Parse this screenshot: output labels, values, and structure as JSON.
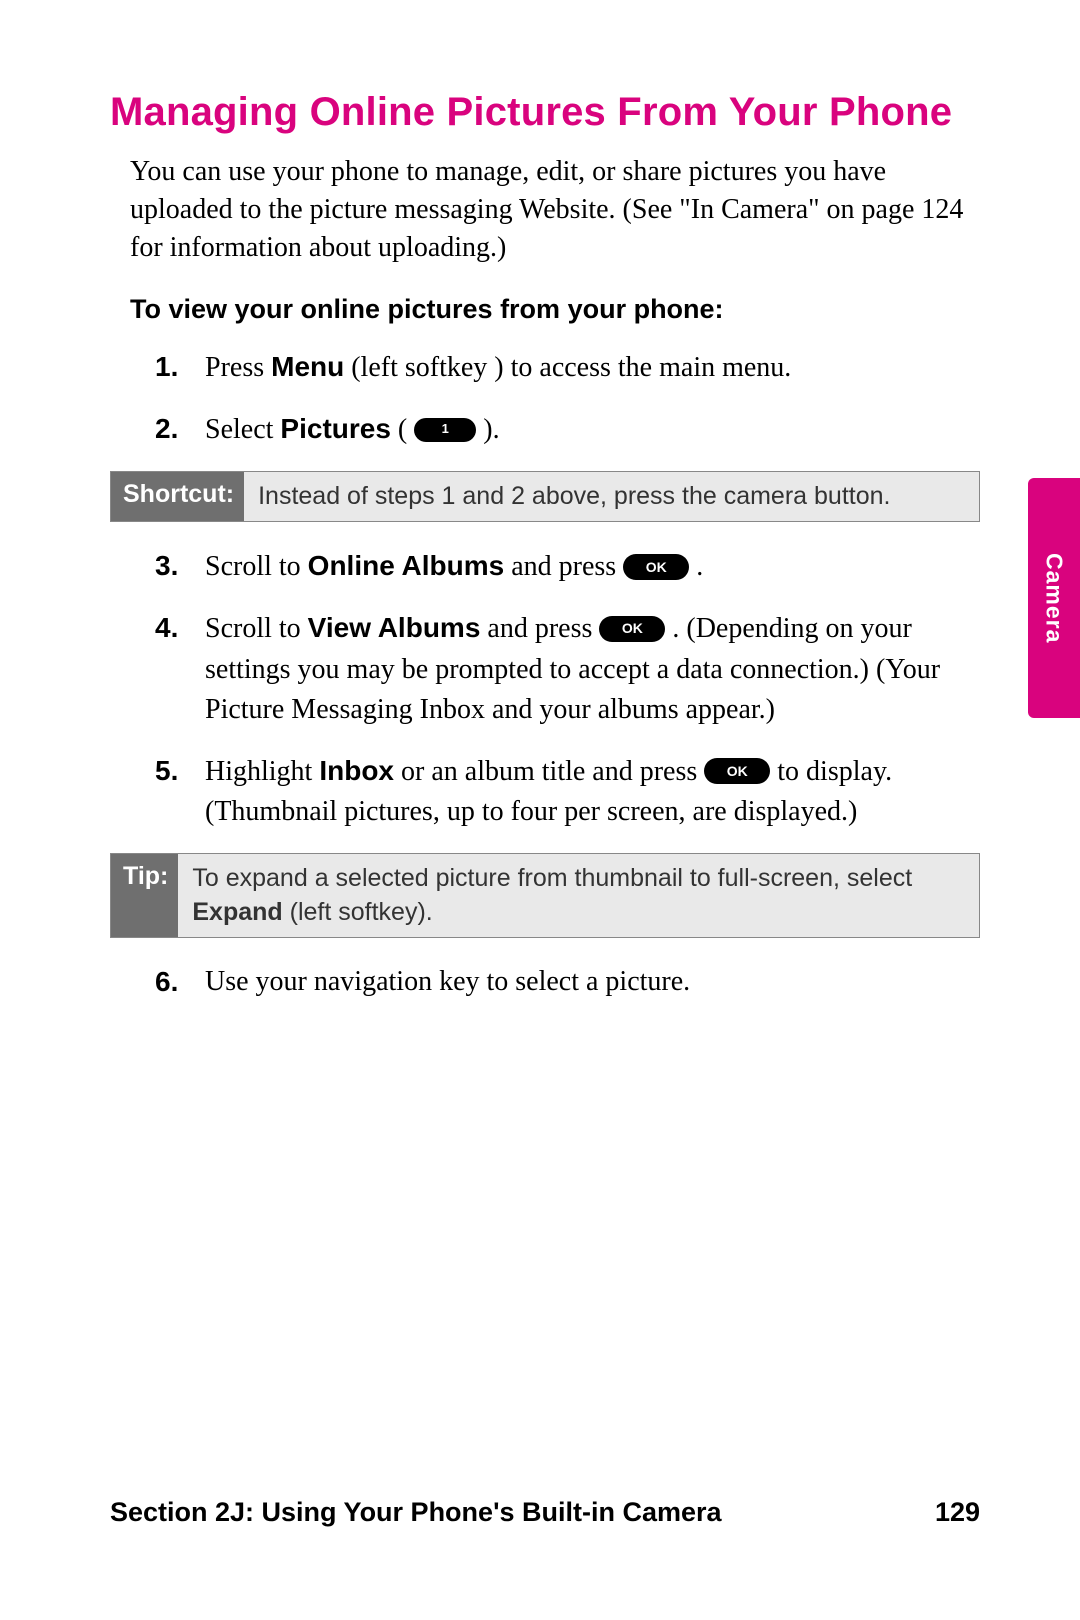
{
  "title": "Managing Online Pictures From Your Phone",
  "intro": "You can use your phone to manage, edit, or share pictures you have uploaded to the picture messaging Website. (See \"In Camera\" on page 124 for information about uploading.)",
  "subhead": "To view your online pictures from your phone:",
  "steps": {
    "s1": {
      "num": "1.",
      "pre": "Press ",
      "bold": "Menu",
      "post": " (left softkey ) to access the main menu."
    },
    "s2": {
      "num": "2.",
      "pre": "Select ",
      "bold": "Pictures",
      "post_open": " ( ",
      "pill": "1",
      "post_close": " )."
    },
    "s3": {
      "num": "3.",
      "pre": "Scroll to ",
      "bold": "Online Albums",
      "mid": " and press ",
      "pill": "OK",
      "post": " ."
    },
    "s4": {
      "num": "4.",
      "pre": "Scroll to ",
      "bold": "View Albums",
      "mid": " and press ",
      "pill": "OK",
      "post": " . (Depending on your settings you may be prompted to accept a data connection.) (Your Picture Messaging Inbox and your albums appear.)"
    },
    "s5": {
      "num": "5.",
      "pre": "Highlight ",
      "bold": "Inbox",
      "mid": " or an album title and press ",
      "pill": "OK",
      "post": " to display. (Thumbnail pictures, up to four per screen, are displayed.)"
    },
    "s6": {
      "num": "6.",
      "text": "Use your navigation key to select a picture."
    }
  },
  "shortcut": {
    "label": "Shortcut:",
    "text": "Instead of steps 1 and 2 above, press the camera button."
  },
  "tip": {
    "label": "Tip:",
    "pre": "To expand a selected picture from thumbnail to full-screen, select ",
    "bold": "Expand",
    "post": " (left softkey)."
  },
  "side_tab": "Camera",
  "footer": {
    "section": "Section 2J: Using Your Phone's Built-in Camera",
    "page": "129"
  }
}
